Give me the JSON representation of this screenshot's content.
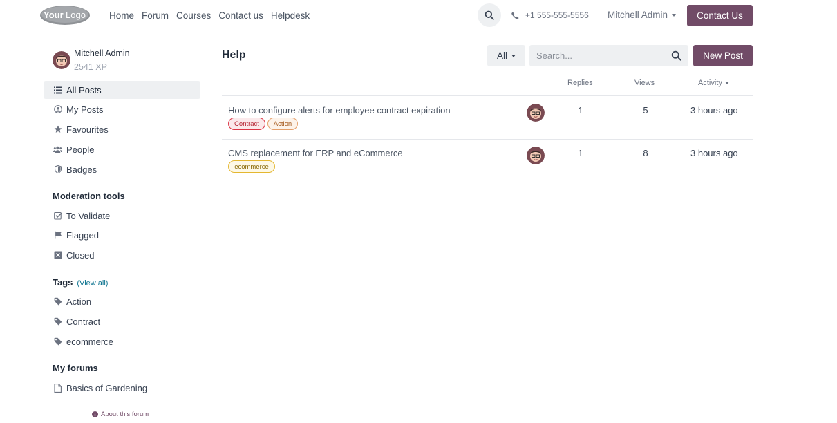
{
  "header": {
    "logo_text": "YourLogo",
    "nav": [
      "Home",
      "Forum",
      "Courses",
      "Contact us",
      "Helpdesk"
    ],
    "phone": "+1 555-555-5556",
    "user_name": "Mitchell Admin",
    "contact_button": "Contact Us"
  },
  "sidebar": {
    "profile": {
      "name": "Mitchell Admin",
      "xp": "2541 XP"
    },
    "items": [
      {
        "label": "All Posts",
        "icon": "list-icon"
      },
      {
        "label": "My Posts",
        "icon": "user-icon"
      },
      {
        "label": "Favourites",
        "icon": "star-icon"
      },
      {
        "label": "People",
        "icon": "users-icon"
      },
      {
        "label": "Badges",
        "icon": "shield-icon"
      }
    ],
    "moderation": {
      "heading": "Moderation tools",
      "items": [
        {
          "label": "To Validate",
          "icon": "check-square-icon"
        },
        {
          "label": "Flagged",
          "icon": "flag-icon"
        },
        {
          "label": "Closed",
          "icon": "close-square-icon"
        }
      ]
    },
    "tags": {
      "heading": "Tags",
      "view_all": "(View all)",
      "items": [
        "Action",
        "Contract",
        "ecommerce"
      ]
    },
    "forums": {
      "heading": "My forums",
      "items": [
        "Basics of Gardening"
      ]
    },
    "about": "About this forum"
  },
  "main": {
    "title": "Help",
    "filter_label": "All",
    "search_placeholder": "Search...",
    "new_post": "New Post",
    "columns": {
      "replies": "Replies",
      "views": "Views",
      "activity": "Activity"
    },
    "posts": [
      {
        "title": "How to configure alerts for employee contract expiration",
        "tags": [
          "Contract",
          "Action"
        ],
        "replies": "1",
        "views": "5",
        "activity": "3 hours ago"
      },
      {
        "title": "CMS replacement for ERP and eCommerce",
        "tags": [
          "ecommerce"
        ],
        "replies": "1",
        "views": "8",
        "activity": "3 hours ago"
      }
    ]
  },
  "colors": {
    "brand": "#714b67",
    "active_bg": "#eef0f2",
    "link": "#0e7490"
  }
}
